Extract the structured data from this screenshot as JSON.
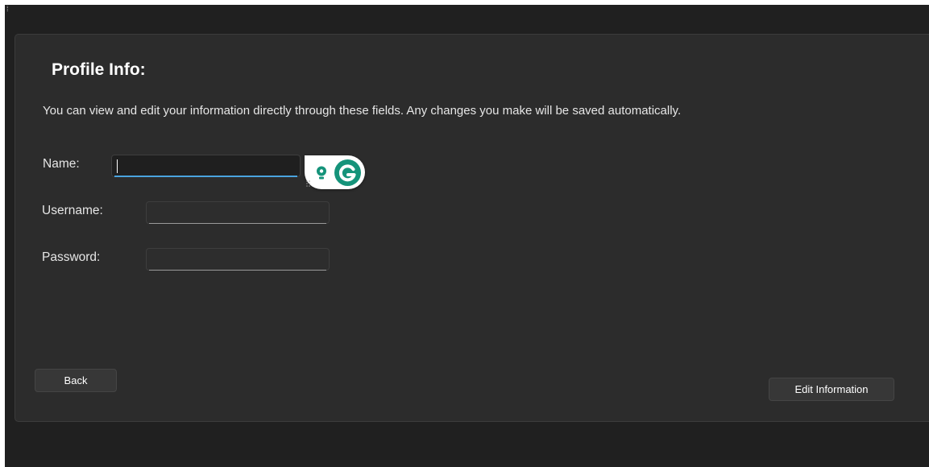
{
  "window": {
    "corner_glyph": "⁞"
  },
  "profile": {
    "title": "Profile Info:",
    "description": "You can view and edit your information directly through these fields. Any changes you make will be saved automatically."
  },
  "fields": {
    "name": {
      "label": "Name:",
      "value": "",
      "placeholder": ""
    },
    "username": {
      "label": "Username:",
      "value": "",
      "placeholder": ""
    },
    "password": {
      "label": "Password:",
      "value": "",
      "placeholder": ""
    }
  },
  "grammarly": {
    "icons": [
      "grip-icon",
      "lightbulb-icon",
      "grammarly-g-icon"
    ],
    "brand_color": "#15937a"
  },
  "buttons": {
    "back_label": "Back",
    "edit_label": "Edit Information"
  },
  "colors": {
    "background": "#202020",
    "card": "#2c2c2c",
    "focus_accent": "#4aa3df"
  }
}
